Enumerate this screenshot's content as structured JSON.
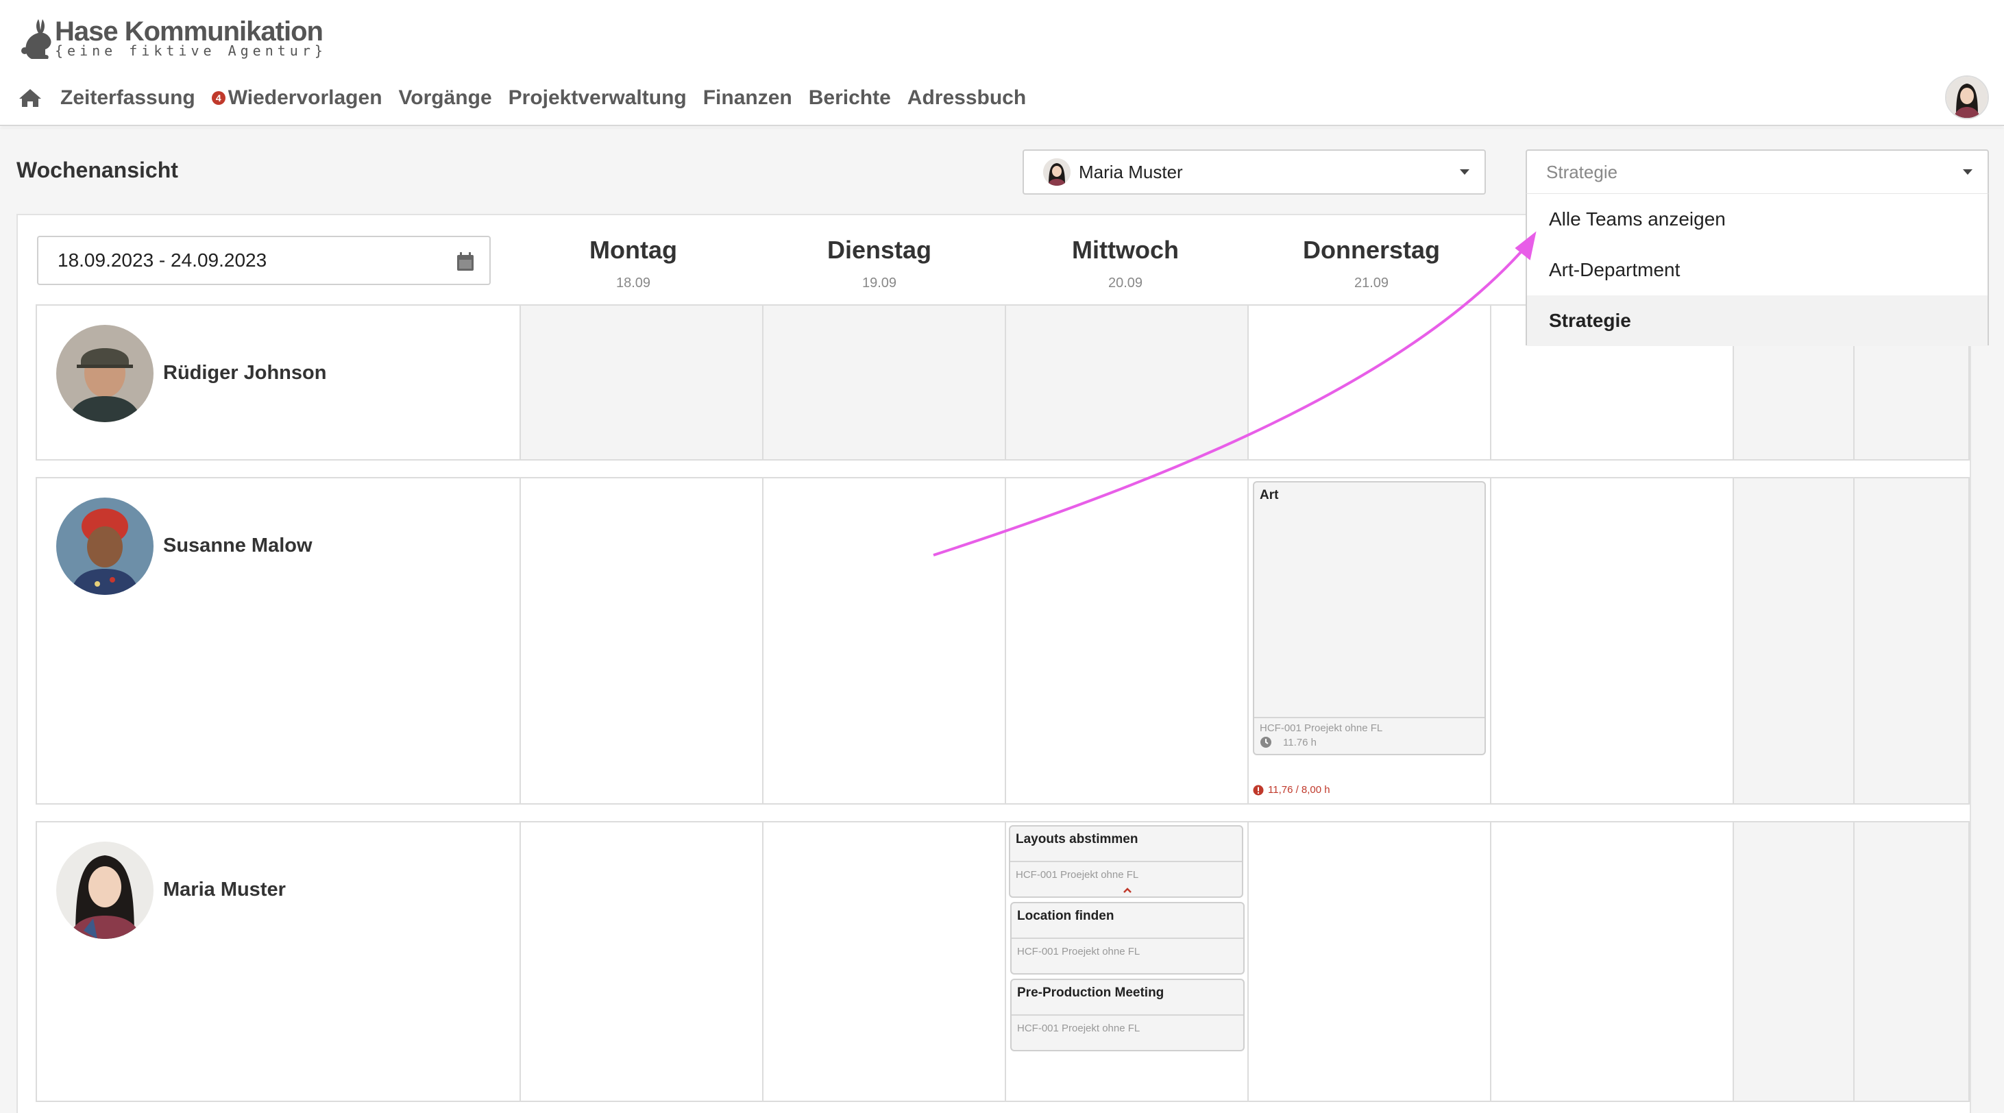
{
  "app": {
    "logo_name": "Hase  Kommunikation",
    "logo_tagline": "{eine fiktive Agentur}"
  },
  "nav": {
    "items": [
      {
        "label": "Zeiterfassung"
      },
      {
        "label": "Wiedervorlagen",
        "badge": "4"
      },
      {
        "label": "Vorgänge"
      },
      {
        "label": "Projektverwaltung"
      },
      {
        "label": "Finanzen"
      },
      {
        "label": "Berichte"
      },
      {
        "label": "Adressbuch"
      }
    ]
  },
  "page": {
    "title": "Wochenansicht",
    "user_select": "Maria Muster",
    "team_select": "Strategie",
    "team_options": [
      {
        "label": "Alle Teams anzeigen",
        "selected": false
      },
      {
        "label": "Art-Department",
        "selected": false
      },
      {
        "label": "Strategie",
        "selected": true
      }
    ],
    "date_range": "18.09.2023 - 24.09.2023"
  },
  "days": [
    {
      "name": "Montag",
      "date": "18.09"
    },
    {
      "name": "Dienstag",
      "date": "19.09"
    },
    {
      "name": "Mittwoch",
      "date": "20.09"
    },
    {
      "name": "Donnerstag",
      "date": "21.09"
    }
  ],
  "people": [
    {
      "name": "Rüdiger Johnson"
    },
    {
      "name": "Susanne Malow"
    },
    {
      "name": "Maria Muster"
    }
  ],
  "entries": {
    "susanne_thursday": {
      "title": "Art",
      "project": "HCF-001 Proejekt ohne FL",
      "hours": "11.76 h",
      "overtime": "11,76 / 8,00 h"
    },
    "maria_wednesday": [
      {
        "title": "Layouts abstimmen",
        "project": "HCF-001 Proejekt ohne FL"
      },
      {
        "title": "Location finden",
        "project": "HCF-001 Proejekt ohne FL"
      },
      {
        "title": "Pre-Production Meeting",
        "project": "HCF-001 Proejekt ohne FL"
      }
    ]
  },
  "colors": {
    "accent_red": "#c0392b",
    "annotation_arrow": "#e85ee8",
    "weekend_gray": "#f4f4f4"
  }
}
